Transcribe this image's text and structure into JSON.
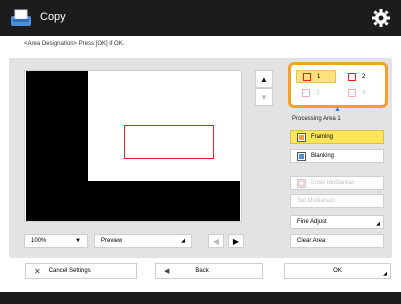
{
  "header": {
    "title": "Copy",
    "copy_icon": "copy-icon",
    "settings_icon": "gear-icon"
  },
  "instruction": "<Area Designation> Press [OK] if OK.",
  "preview": {
    "frame_color": "#e32222",
    "zoom": "100%",
    "view_mode": "Preview"
  },
  "areas": {
    "items": [
      {
        "label": "1",
        "selected": true,
        "enabled": true
      },
      {
        "label": "2",
        "selected": false,
        "enabled": true
      },
      {
        "label": "3",
        "selected": false,
        "enabled": false
      },
      {
        "label": "4",
        "selected": false,
        "enabled": false
      }
    ],
    "highlight_color": "#f1a12c"
  },
  "processing": {
    "label": "Processing Area 1",
    "framing": "Framing",
    "blanking": "Blanking"
  },
  "multi": {
    "enter": "Enter Multiareas",
    "set": "Set Multiareas"
  },
  "actions": {
    "fine_adjust": "Fine Adjust",
    "clear_area": "Clear Area"
  },
  "footer": {
    "cancel": "Cancel Settings",
    "back": "Back",
    "ok": "OK"
  }
}
